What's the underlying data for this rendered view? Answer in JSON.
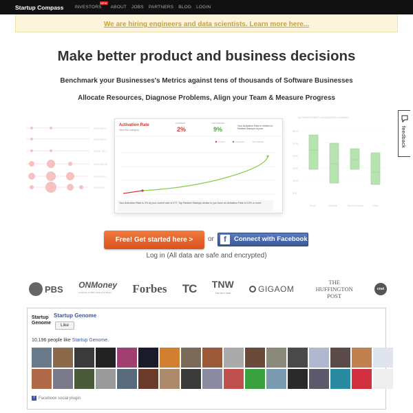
{
  "topbar": {
    "brand": "Startup Compass",
    "nav": [
      "INVESTORS",
      "ABOUT",
      "JOBS",
      "PARTNERS",
      "BLOG",
      "LOGIN"
    ],
    "new_badge": "NEW"
  },
  "hiring_banner": "We are hiring engineers and data scientists. Learn more here...",
  "headline": "Make better product and business decisions",
  "subline_1": "Benchmark your Businesses's Metrics against tens of thousands of Software Businesses",
  "subline_2": "Allocate Resources, Diagnose Problems, Align your Team & Measure Progress",
  "dashboard": {
    "metric_title": "Activation Rate",
    "metric_sub": "View this Category",
    "current_label": "CURRENT",
    "current_value": "2%",
    "top_label": "TOP RANKED",
    "top_value": "9%",
    "percentile_text": "Your Activation Rate in relation to Ranked Startups is poor",
    "footer_text": "Your Activation Rate is 2% at your current rate of 277. Top Ranked Startups similar to you have an Activation Rate of 10% or more.",
    "legend": [
      "Current",
      "Projected",
      "Top Ranked"
    ],
    "right_chart_title": "ACTIVATION RATE / ACQUISITION CHANNEL",
    "right_y_ticks": [
      "50%",
      "40%",
      "30%",
      "20%",
      "10%",
      "0%"
    ],
    "right_x_ticks": [
      "Email",
      "Referral",
      "Word of Mouth",
      "Other"
    ],
    "left_row_labels": [
      "SEM   SEO",
      "SEM   SEO",
      "WOM   SEO",
      "SEM   WOM",
      "SEM   SEO",
      "SEM   PR"
    ]
  },
  "cta": {
    "signup_label": "Free! Get started here >",
    "or_label": "or",
    "facebook_label": "Connect with Facebook",
    "fb_icon": "f",
    "login_label": "Log in (All data are safe and encrypted)"
  },
  "press": [
    "PBS",
    "ONMoney",
    "Forbes",
    "TC",
    "TNW",
    "GIGAOM",
    "THE HUFFINGTON POST",
    "cnet"
  ],
  "press_sub": {
    "onmoney": "A Service of CNN, Fortune & Money",
    "tnw": "THE NEXT WEB"
  },
  "facebook_widget": {
    "logo_text": "Startup Genome",
    "page_name": "Startup Genome",
    "like_label": "Like",
    "like_count_prefix": "10,196 people like ",
    "like_count_link": "Startup Genome",
    "like_count_suffix": ".",
    "plugin_label": "Facebook social plugin",
    "faces_row1": [
      "#6a7a8a",
      "#8a6a4a",
      "#3a3a3a",
      "#222222",
      "#a04070",
      "#1a1a2a",
      "#d08030",
      "#7a6a5a",
      "#9a5a3a",
      "#aaaaaa",
      "#6a4a3a",
      "#8a8a7a",
      "#4a4a4a",
      "#b0b8d0",
      "#5a4a4a",
      "#c08050",
      "#e0e4ee"
    ],
    "faces_row2": [
      "#b06a4a",
      "#7a7a8a",
      "#4a5a3a",
      "#9a9a9a",
      "#5a6a7a",
      "#6a3a2a",
      "#aa8a6a",
      "#3a3a3a",
      "#8a8aa0",
      "#c05050",
      "#3aa040",
      "#7a9ab0",
      "#2a2a2a",
      "#5a5a6a",
      "#2a8aa0",
      "#d03040",
      "#eeeeee"
    ],
    "feedback_label": "feedback"
  }
}
